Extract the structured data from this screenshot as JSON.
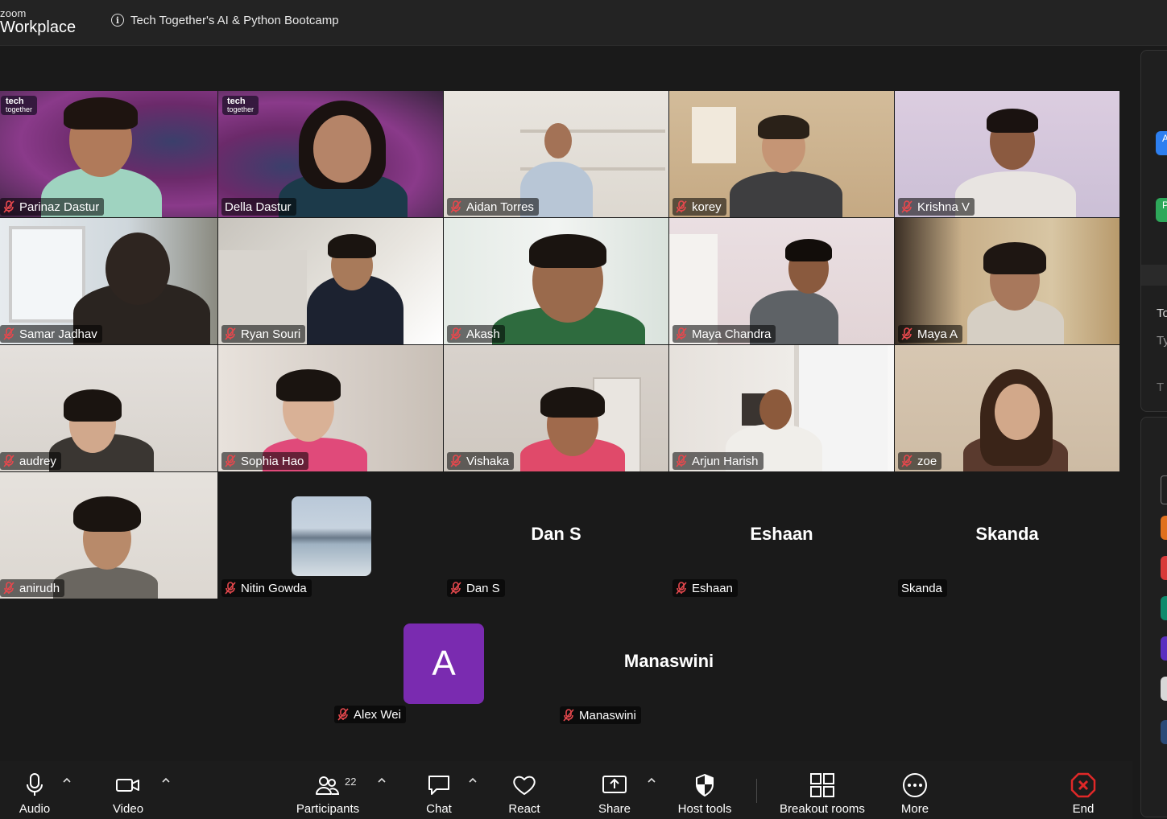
{
  "app": {
    "logo_top": "zoom",
    "logo_bottom": "Workplace",
    "meeting_title": "Tech Together's AI & Python Bootcamp"
  },
  "brand_badge": {
    "line1": "tech",
    "line2": "together"
  },
  "participants": [
    {
      "name": "Parinaz Dastur",
      "muted": true
    },
    {
      "name": "Della Dastur",
      "muted": false,
      "active_speaker": true
    },
    {
      "name": "Aidan Torres",
      "muted": true
    },
    {
      "name": "korey",
      "muted": true
    },
    {
      "name": "Krishna V",
      "muted": true
    },
    {
      "name": "Samar Jadhav",
      "muted": true
    },
    {
      "name": "Ryan Souri",
      "muted": true
    },
    {
      "name": "Akash",
      "muted": true
    },
    {
      "name": "Maya Chandra",
      "muted": true
    },
    {
      "name": "Maya A",
      "muted": true
    },
    {
      "name": "audrey",
      "muted": true
    },
    {
      "name": "Sophia Hao",
      "muted": true
    },
    {
      "name": "Vishaka",
      "muted": true
    },
    {
      "name": "Arjun Harish",
      "muted": true
    },
    {
      "name": "zoe",
      "muted": true
    },
    {
      "name": "anirudh",
      "muted": true
    },
    {
      "name": "Nitin Gowda",
      "muted": true
    },
    {
      "name": "Dan S",
      "muted": true,
      "center_label": "Dan S"
    },
    {
      "name": "Eshaan",
      "muted": true,
      "center_label": "Eshaan"
    },
    {
      "name": "Skanda",
      "muted": false,
      "center_label": "Skanda"
    },
    {
      "name": "Alex Wei",
      "muted": true,
      "avatar_letter": "A"
    },
    {
      "name": "Manaswini",
      "muted": true,
      "center_label": "Manaswini"
    }
  ],
  "side_panel": {
    "text1": "To",
    "text2": "Ty",
    "text3": "T",
    "chip1": "A",
    "chip2": "P"
  },
  "toolbar": {
    "audio": "Audio",
    "video": "Video",
    "participants": "Participants",
    "participants_count": "22",
    "chat": "Chat",
    "react": "React",
    "share": "Share",
    "host_tools": "Host tools",
    "breakout_rooms": "Breakout rooms",
    "more": "More",
    "end": "End"
  },
  "colors": {
    "active_speaker_border": "#2bd56a",
    "end_red": "#e02828",
    "avatar_purple": "#7a2bb0",
    "mute_red": "#e5484d"
  }
}
